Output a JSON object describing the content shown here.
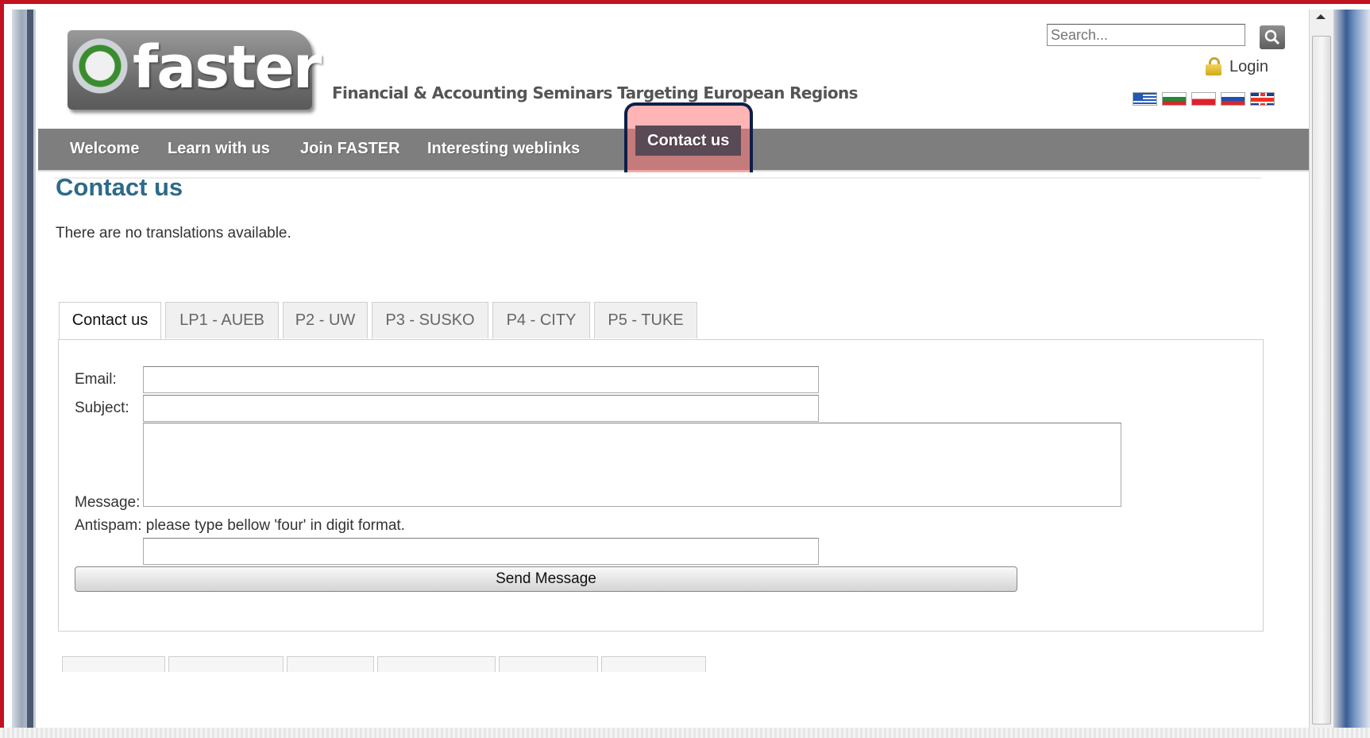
{
  "header": {
    "logo_text": "faster",
    "tagline": "Financial & Accounting Seminars Targeting European Regions",
    "search_placeholder": "Search...",
    "login_label": "Login",
    "languages": [
      "Greek",
      "Bulgarian",
      "Polish",
      "Slovak",
      "English"
    ]
  },
  "nav": {
    "items": [
      {
        "label": "Welcome"
      },
      {
        "label": "Learn with us"
      },
      {
        "label": "Join FASTER"
      },
      {
        "label": "Interesting weblinks"
      },
      {
        "label": "Contact us"
      }
    ],
    "active_index": 4
  },
  "main": {
    "title": "Contact us",
    "notice": "There are no translations available.",
    "tabs": [
      {
        "label": "Contact us"
      },
      {
        "label": "LP1 - AUEB"
      },
      {
        "label": "P2 - UW"
      },
      {
        "label": "P3 - SUSKO"
      },
      {
        "label": "P4 - CITY"
      },
      {
        "label": "P5 - TUKE"
      }
    ],
    "form": {
      "email_label": "Email:",
      "email_value": "",
      "subject_label": "Subject:",
      "subject_value": "",
      "message_label": "Message:",
      "message_value": "",
      "antispam_label": "Antispam: please type bellow 'four' in digit format.",
      "antispam_value": "",
      "send_label": "Send Message"
    }
  },
  "colors": {
    "nav_bg": "#7e7e7e",
    "nav_active_bg": "#5a4a55",
    "title_color": "#2d6a8a",
    "highlight": "#ff7878",
    "frame_border": "#c1121f"
  }
}
